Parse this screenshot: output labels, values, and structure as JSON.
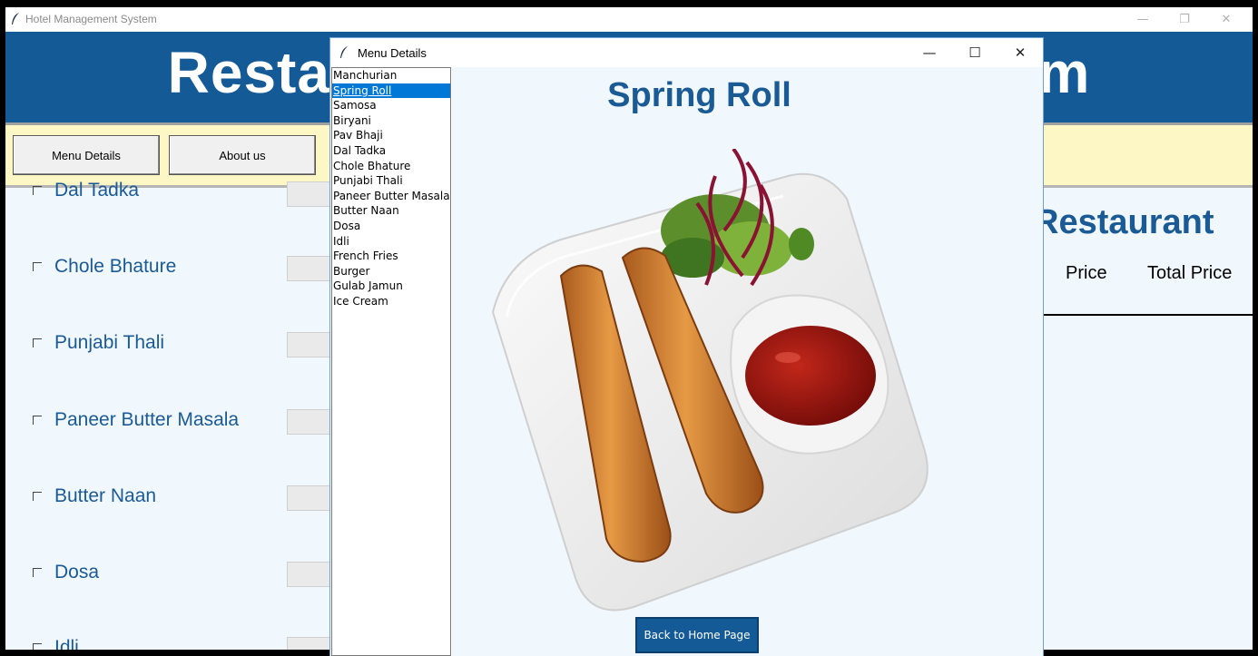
{
  "main_window": {
    "title": "Hotel Management System",
    "banner_text": "Restaurant Management System",
    "nav_buttons": [
      "Menu Details",
      "About us"
    ],
    "items": [
      {
        "label": "Dal Tadka"
      },
      {
        "label": "Chole Bhature"
      },
      {
        "label": "Punjabi Thali"
      },
      {
        "label": "Paneer Butter Masala"
      },
      {
        "label": "Butter Naan"
      },
      {
        "label": "Dosa"
      },
      {
        "label": "Idli"
      }
    ],
    "right_heading": "Restaurant",
    "columns": [
      "Price",
      "Total Price"
    ]
  },
  "menu_window": {
    "title": "Menu Details",
    "list": [
      "Manchurian",
      "Spring Roll",
      "Samosa",
      "Biryani",
      "Pav Bhaji",
      "Dal Tadka",
      "Chole Bhature",
      "Punjabi Thali",
      "Paneer Butter Masala",
      "Butter Naan",
      "Dosa",
      "Idli",
      "French Fries",
      "Burger",
      "Gulab Jamun",
      "Ice Cream"
    ],
    "selected": "Spring Roll",
    "dish_title": "Spring Roll",
    "back_button": "Back to Home Page"
  },
  "icons": {
    "app": "feather-icon",
    "minimize": "minimize-icon",
    "maximize": "maximize-icon",
    "close": "close-icon",
    "checkbox": "checkbox-icon"
  },
  "colors": {
    "banner": "#145a96",
    "navbar": "#fdf6c5",
    "accent_text": "#1a5a95",
    "selection": "#0078d7",
    "content_bg": "#f0f7fd"
  }
}
